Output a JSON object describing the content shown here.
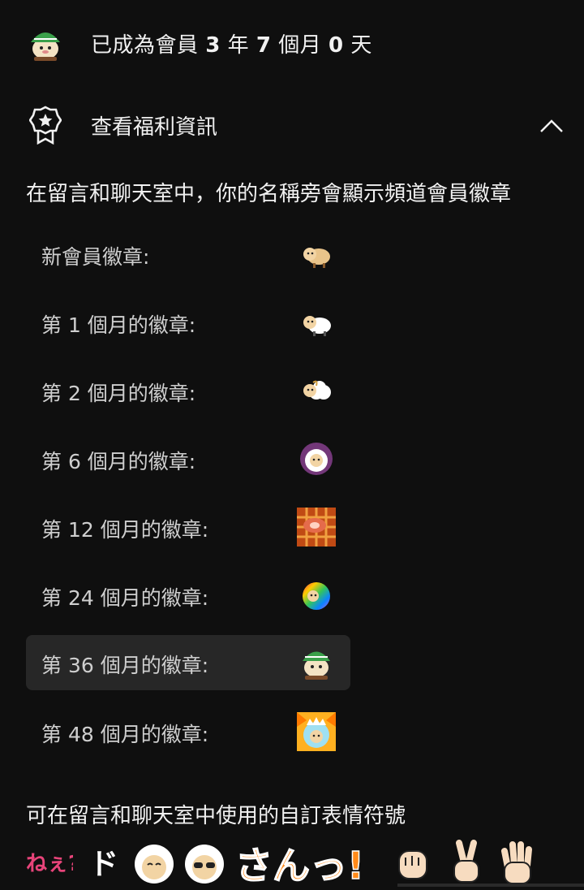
{
  "membership": {
    "text_prefix": "已成為會員 ",
    "years": "3",
    "years_unit": " 年 ",
    "months": "7",
    "months_unit": " 個月 ",
    "days": "0",
    "days_unit": " 天"
  },
  "benefits": {
    "label": "查看福利資訊",
    "expanded": true
  },
  "description": "在留言和聊天室中，你的名稱旁會顯示頻道會員徽章",
  "badges": [
    {
      "label": "新會員徽章:",
      "icon": "sheep-tan-icon"
    },
    {
      "label": "第 1 個月的徽章:",
      "icon": "sheep-white-icon"
    },
    {
      "label": "第 2 個月的徽章:",
      "icon": "sheep-white-fluffy-icon"
    },
    {
      "label": "第 6 個月的徽章:",
      "icon": "sheep-pink-glow-icon"
    },
    {
      "label": "第 12 個月的徽章:",
      "icon": "grill-meat-icon"
    },
    {
      "label": "第 24 個月的徽章:",
      "icon": "rainbow-sheep-icon"
    },
    {
      "label": "第 36 個月的徽章:",
      "icon": "sheep-helmet-icon",
      "highlighted": true
    },
    {
      "label": "第 48 個月的徽章:",
      "icon": "sheep-monster-icon"
    }
  ],
  "emoji_section_title": "可在留言和聊天室中使用的自訂表情符號",
  "emojis": [
    "ねぇ?",
    "ド",
    "sheep-smile",
    "sheep-sunglasses",
    "さんっ!",
    "fist",
    "peace",
    "open-hand"
  ],
  "colors": {
    "background": "#0f0f0f",
    "highlight": "#272727",
    "text_primary": "#f1f1f1",
    "text_secondary": "#cfcfcf"
  }
}
